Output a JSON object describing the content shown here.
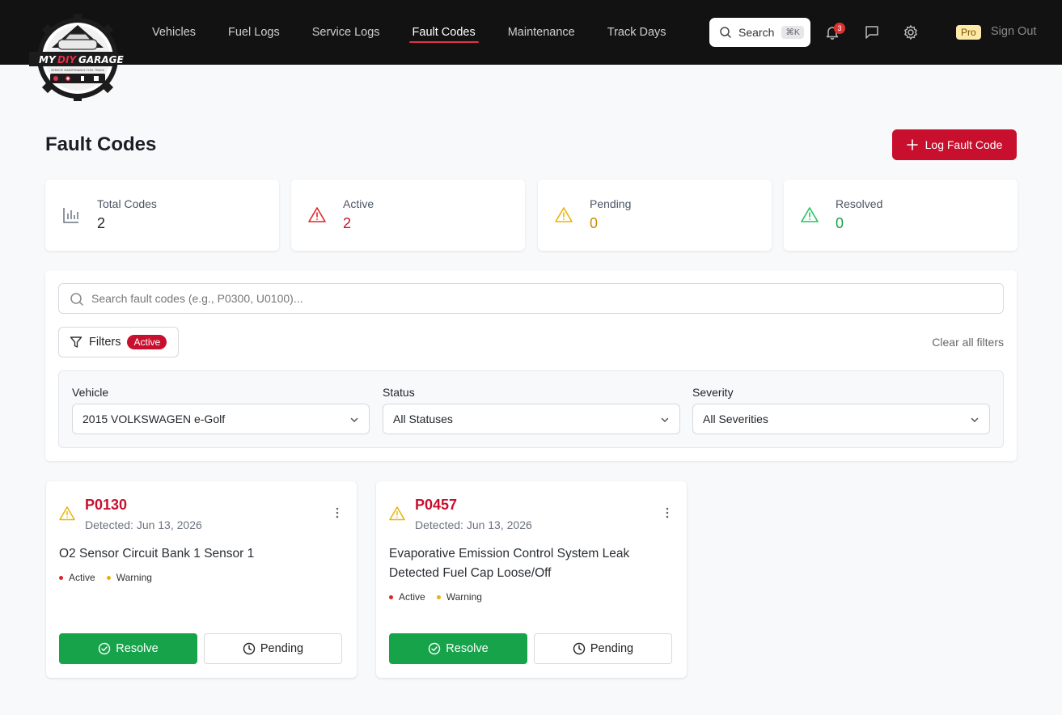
{
  "brand": {
    "logo_text_my": "MY",
    "logo_text_diy": "DIY",
    "logo_text_garage": "GARAGE",
    "logo_tagline": "SERVICE MAINTENANCE FUEL TRACK"
  },
  "nav": {
    "items": [
      {
        "label": "Vehicles"
      },
      {
        "label": "Fuel Logs"
      },
      {
        "label": "Service Logs"
      },
      {
        "label": "Fault Codes",
        "active": true
      },
      {
        "label": "Maintenance"
      },
      {
        "label": "Track Days"
      }
    ],
    "search_label": "Search",
    "search_shortcut": "⌘K",
    "notification_count": "3",
    "pro_label": "Pro",
    "signout_label": "Sign Out"
  },
  "page": {
    "title": "Fault Codes",
    "log_button_label": "Log Fault Code"
  },
  "stats": [
    {
      "label": "Total Codes",
      "value": "2",
      "color": "#1f2328"
    },
    {
      "label": "Active",
      "value": "2",
      "color": "#c8102e"
    },
    {
      "label": "Pending",
      "value": "0",
      "color": "#ca8a04"
    },
    {
      "label": "Resolved",
      "value": "0",
      "color": "#16a34a"
    }
  ],
  "filters": {
    "search_placeholder": "Search fault codes (e.g., P0300, U0100)...",
    "filters_label": "Filters",
    "active_badge": "Active",
    "clear_label": "Clear all filters",
    "vehicle": {
      "label": "Vehicle",
      "value": "2015 VOLKSWAGEN e-Golf"
    },
    "status": {
      "label": "Status",
      "value": "All Statuses"
    },
    "severity": {
      "label": "Severity",
      "value": "All Severities"
    }
  },
  "fault_codes": [
    {
      "code": "P0130",
      "detected": "Detected: Jun 13, 2026",
      "description": "O2 Sensor Circuit Bank 1 Sensor 1",
      "status_tag": "Active",
      "severity_tag": "Warning",
      "resolve_label": "Resolve",
      "pending_label": "Pending"
    },
    {
      "code": "P0457",
      "detected": "Detected: Jun 13, 2026",
      "description": "Evaporative Emission Control System Leak Detected Fuel Cap Loose/Off",
      "status_tag": "Active",
      "severity_tag": "Warning",
      "resolve_label": "Resolve",
      "pending_label": "Pending"
    }
  ],
  "colors": {
    "accent": "#c8102e",
    "success": "#16a34a",
    "warning": "#eab308",
    "topbar": "#121212"
  }
}
